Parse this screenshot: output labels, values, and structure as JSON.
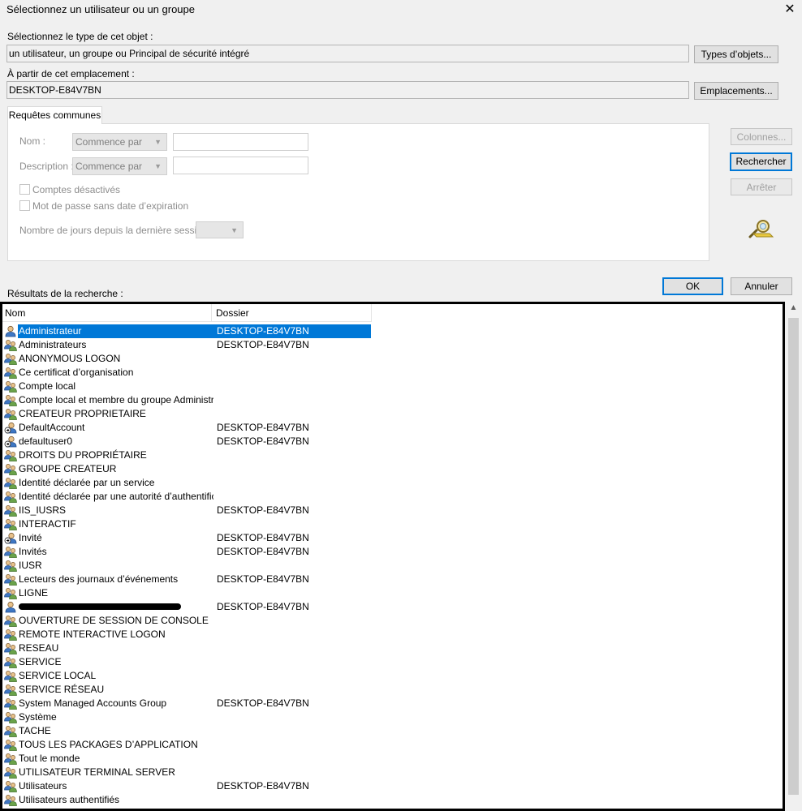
{
  "window": {
    "title": "Sélectionnez un utilisateur ou un groupe",
    "close_glyph": "✕"
  },
  "object_type": {
    "label": "Sélectionnez le type de cet objet :",
    "value": "un utilisateur, un groupe ou Principal de sécurité intégré",
    "button": "Types d’objets..."
  },
  "location": {
    "label": "À partir de cet emplacement :",
    "value": "DESKTOP-E84V7BN",
    "button": "Emplacements..."
  },
  "common_queries": {
    "tab_label": "Requêtes communes",
    "name_label": "Nom :",
    "name_mode": "Commence par",
    "name_value": "",
    "description_label": "Description :",
    "description_mode": "Commence par",
    "description_value": "",
    "disabled_accounts": "Comptes désactivés",
    "non_expiring_password": "Mot de passe sans date d’expiration",
    "days_since_logon_label": "Nombre de jours depuis la dernière session :",
    "days_since_logon_value": ""
  },
  "side_buttons": {
    "columns": "Colonnes...",
    "search": "Rechercher",
    "stop": "Arrêter"
  },
  "search_icon": "search-binoculars-icon",
  "results_label": "Résultats de la recherche :",
  "dialog_buttons": {
    "ok": "OK",
    "cancel": "Annuler"
  },
  "results": {
    "columns": [
      "Nom",
      "Dossier"
    ],
    "rows": [
      {
        "name": "Administrateur",
        "folder": "DESKTOP-E84V7BN",
        "icon": "user-icon",
        "selected": true
      },
      {
        "name": "Administrateurs",
        "folder": "DESKTOP-E84V7BN",
        "icon": "group-icon"
      },
      {
        "name": "ANONYMOUS LOGON",
        "folder": "",
        "icon": "group-icon"
      },
      {
        "name": "Ce certificat d’organisation",
        "folder": "",
        "icon": "group-icon"
      },
      {
        "name": "Compte local",
        "folder": "",
        "icon": "group-icon"
      },
      {
        "name": "Compte local et membre du groupe Administrate...",
        "folder": "",
        "icon": "group-icon"
      },
      {
        "name": "CREATEUR PROPRIETAIRE",
        "folder": "",
        "icon": "group-icon"
      },
      {
        "name": "DefaultAccount",
        "folder": "DESKTOP-E84V7BN",
        "icon": "disabled-user-icon"
      },
      {
        "name": "defaultuser0",
        "folder": "DESKTOP-E84V7BN",
        "icon": "disabled-user-icon"
      },
      {
        "name": "DROITS DU PROPRIÉTAIRE",
        "folder": "",
        "icon": "group-icon"
      },
      {
        "name": "GROUPE CREATEUR",
        "folder": "",
        "icon": "group-icon"
      },
      {
        "name": "Identité déclarée par un service",
        "folder": "",
        "icon": "group-icon"
      },
      {
        "name": "Identité déclarée par une autorité d’authentificati...",
        "folder": "",
        "icon": "group-icon"
      },
      {
        "name": "IIS_IUSRS",
        "folder": "DESKTOP-E84V7BN",
        "icon": "group-icon"
      },
      {
        "name": "INTERACTIF",
        "folder": "",
        "icon": "group-icon"
      },
      {
        "name": "Invité",
        "folder": "DESKTOP-E84V7BN",
        "icon": "disabled-user-icon"
      },
      {
        "name": "Invités",
        "folder": "DESKTOP-E84V7BN",
        "icon": "group-icon"
      },
      {
        "name": "IUSR",
        "folder": "",
        "icon": "group-icon"
      },
      {
        "name": "Lecteurs des journaux d’événements",
        "folder": "DESKTOP-E84V7BN",
        "icon": "group-icon"
      },
      {
        "name": "LIGNE",
        "folder": "",
        "icon": "group-icon"
      },
      {
        "name": "",
        "folder": "DESKTOP-E84V7BN",
        "icon": "user-icon",
        "redacted": true
      },
      {
        "name": "OUVERTURE DE SESSION DE CONSOLE",
        "folder": "",
        "icon": "group-icon"
      },
      {
        "name": "REMOTE INTERACTIVE LOGON",
        "folder": "",
        "icon": "group-icon"
      },
      {
        "name": "RESEAU",
        "folder": "",
        "icon": "group-icon"
      },
      {
        "name": "SERVICE",
        "folder": "",
        "icon": "group-icon"
      },
      {
        "name": "SERVICE LOCAL",
        "folder": "",
        "icon": "group-icon"
      },
      {
        "name": "SERVICE RÉSEAU",
        "folder": "",
        "icon": "group-icon"
      },
      {
        "name": "System Managed Accounts Group",
        "folder": "DESKTOP-E84V7BN",
        "icon": "group-icon"
      },
      {
        "name": "Système",
        "folder": "",
        "icon": "group-icon"
      },
      {
        "name": "TACHE",
        "folder": "",
        "icon": "group-icon"
      },
      {
        "name": "TOUS LES PACKAGES D’APPLICATION",
        "folder": "",
        "icon": "group-icon"
      },
      {
        "name": "Tout le monde",
        "folder": "",
        "icon": "group-icon"
      },
      {
        "name": "UTILISATEUR TERMINAL SERVER",
        "folder": "",
        "icon": "group-icon"
      },
      {
        "name": "Utilisateurs",
        "folder": "DESKTOP-E84V7BN",
        "icon": "group-icon"
      },
      {
        "name": "Utilisateurs authentifiés",
        "folder": "",
        "icon": "group-icon"
      }
    ]
  },
  "colors": {
    "selection": "#0078d7",
    "dialog_bg": "#f0f0f0"
  }
}
